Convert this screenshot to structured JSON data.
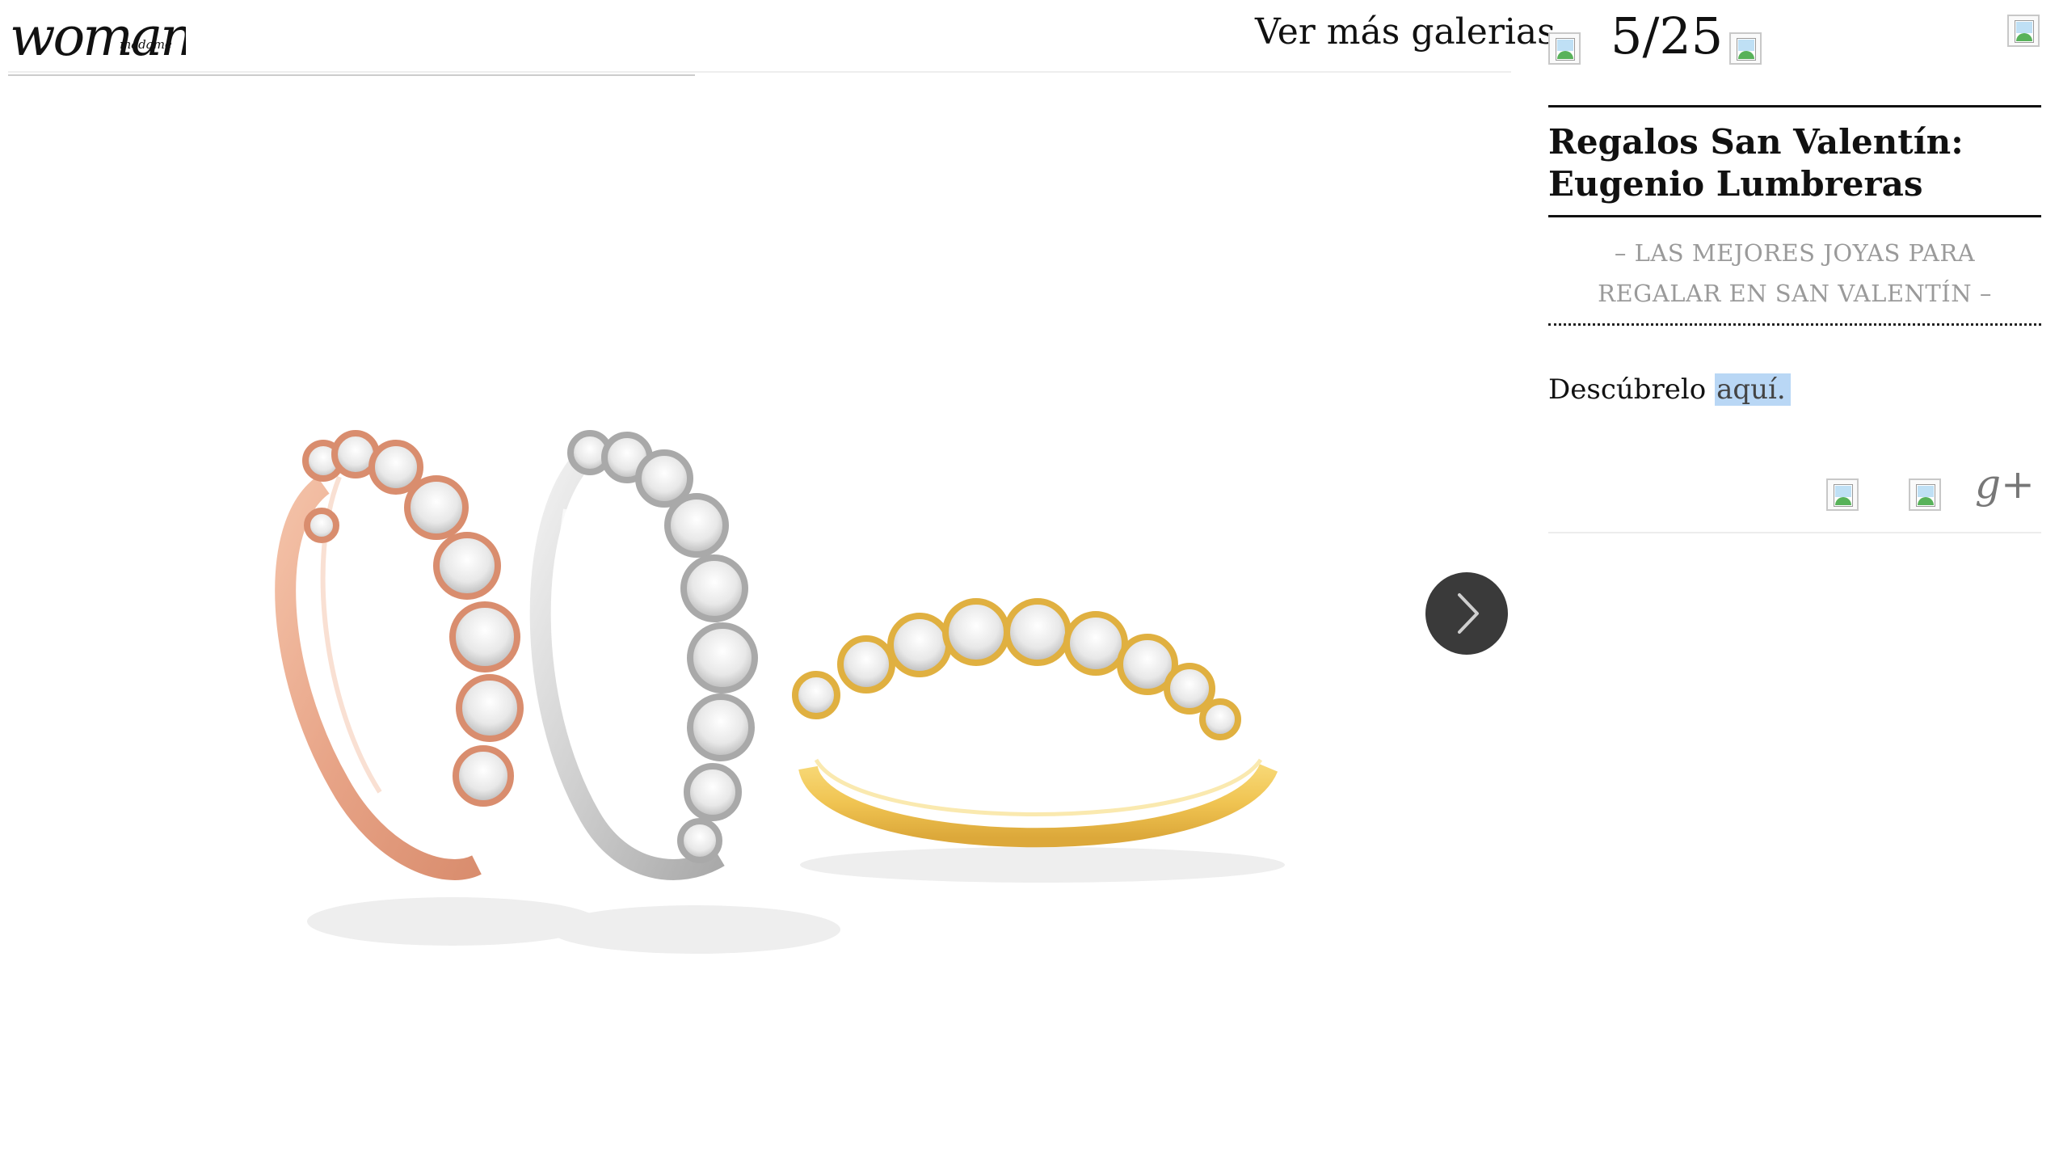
{
  "header": {
    "logo_text": "woman",
    "logo_subtext": "madame",
    "more_galleries_label": "Ver más galerias"
  },
  "gallery": {
    "counter": "5/25",
    "prev_icon": "broken-image-icon",
    "next_icon": "broken-image-icon",
    "close_icon": "broken-image-icon",
    "next_button_icon": "chevron-right-icon"
  },
  "article": {
    "title": "Regalos San Valentín: Eugenio Lumbreras",
    "subtitle": "– LAS MEJORES JOYAS PARA REGALAR EN SAN VALENTÍN –",
    "discover_text": "Descúbrelo",
    "discover_link": "aquí."
  },
  "share": {
    "icons": [
      "broken-image-icon",
      "broken-image-icon",
      "google-plus-icon"
    ],
    "gplus_label": "g+"
  },
  "photo": {
    "subject": "three rings",
    "ring_colors": [
      "#e9a98e",
      "#d6d6d6",
      "#f0c85a"
    ]
  }
}
